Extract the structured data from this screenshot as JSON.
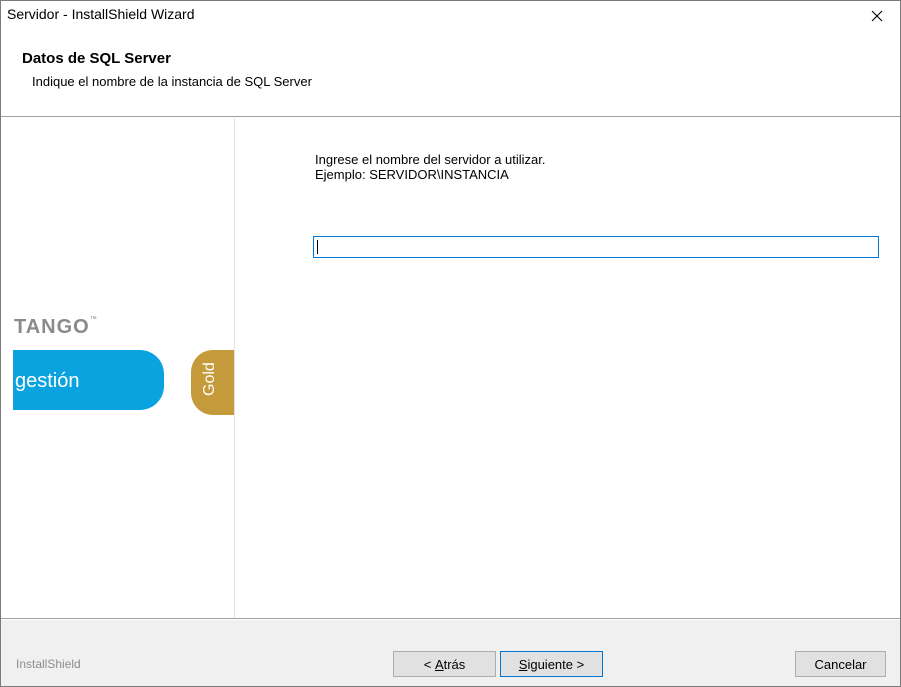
{
  "window": {
    "title": "Servidor - InstallShield Wizard",
    "close_glyph": "✕"
  },
  "header": {
    "title": "Datos de SQL Server",
    "subtitle": "Indique el nombre de la instancia de SQL Server"
  },
  "branding": {
    "tango": "TANGO",
    "tango_tm": "™",
    "gestion": "gestión",
    "gold": "Gold",
    "colors": {
      "gestion_blue": "#0aa3e0",
      "gold": "#c49a3a",
      "tango_gray": "#8a8a8a"
    }
  },
  "main": {
    "instruction_line1": "Ingrese el nombre del servidor a utilizar.",
    "instruction_line2": "Ejemplo: SERVIDOR\\INSTANCIA",
    "server_input_value": ""
  },
  "footer": {
    "brand": "InstallShield",
    "back_prefix": "< ",
    "back_accel": "A",
    "back_rest": "trás",
    "next_accel": "S",
    "next_rest": "iguiente >",
    "cancel_label": "Cancelar"
  },
  "colors": {
    "focus_blue": "#0078d7",
    "button_face": "#e1e1e1"
  }
}
